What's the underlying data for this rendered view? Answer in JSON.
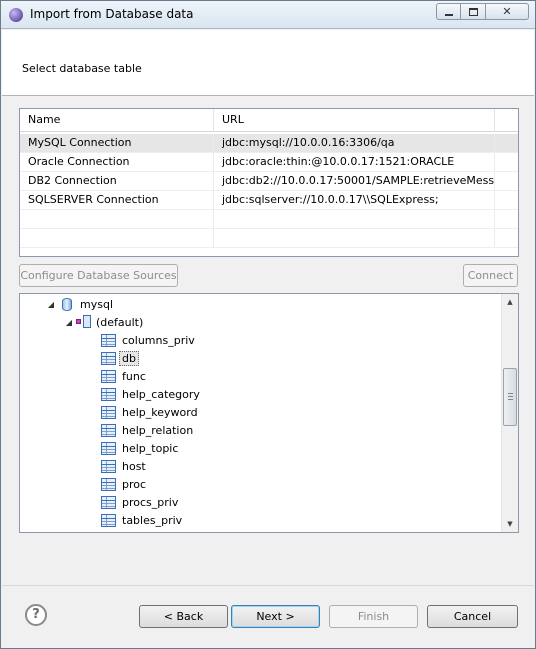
{
  "window": {
    "title": "Import from Database data"
  },
  "banner": {
    "text": "Select database table"
  },
  "table": {
    "headers": [
      "Name",
      "URL"
    ],
    "rows": [
      {
        "name": "MySQL Connection",
        "url": "jdbc:mysql://10.0.0.16:3306/qa",
        "selected": true
      },
      {
        "name": "Oracle Connection",
        "url": "jdbc:oracle:thin:@10.0.0.17:1521:ORACLE"
      },
      {
        "name": "DB2 Connection",
        "url": "jdbc:db2://10.0.0.17:50001/SAMPLE:retrieveMess..."
      },
      {
        "name": "SQLSERVER Connection",
        "url": "jdbc:sqlserver://10.0.0.17\\\\SQLExpress;"
      }
    ]
  },
  "buttons": {
    "configure": "Configure Database Sources",
    "connect": "Connect",
    "back": "< Back",
    "next": "Next >",
    "finish": "Finish",
    "cancel": "Cancel"
  },
  "tree": {
    "database": "mysql",
    "schema": "(default)",
    "tables": [
      "columns_priv",
      "db",
      "func",
      "help_category",
      "help_keyword",
      "help_relation",
      "help_topic",
      "host",
      "proc",
      "procs_priv",
      "tables_priv"
    ],
    "selected_table": "db"
  },
  "icons": {
    "app": "eclipse-icon",
    "help": "help-icon",
    "database": "database-icon",
    "schema": "schema-icon",
    "table": "table-icon"
  },
  "colors": {
    "selection": "#e6e6e6",
    "icon_blue": "#3a6fb7",
    "default_button_border": "#3c7fb1"
  }
}
